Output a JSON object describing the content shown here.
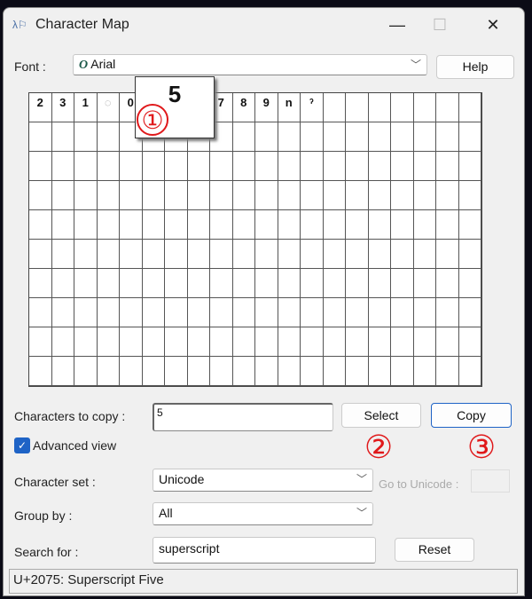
{
  "window": {
    "title": "Character Map",
    "minimize": "—",
    "maximize": "☐",
    "close": "✕"
  },
  "font": {
    "label": "Font :",
    "value": "Arial",
    "font_icon": "O",
    "help": "Help"
  },
  "grid": {
    "columns": 20,
    "rows": 10,
    "cells": [
      "2",
      "3",
      "1",
      "◌",
      "0",
      "",
      "",
      "",
      "7",
      "8",
      "9",
      "n",
      "ˀ"
    ]
  },
  "popup": {
    "char": "5"
  },
  "copy": {
    "label": "Characters to copy :",
    "value": "5",
    "select": "Select",
    "copy": "Copy"
  },
  "advanced": {
    "label": "Advanced view",
    "checked": true
  },
  "charset": {
    "label": "Character set :",
    "value": "Unicode",
    "goto_label": "Go to Unicode :",
    "goto_value": ""
  },
  "groupby": {
    "label": "Group by :",
    "value": "All"
  },
  "search": {
    "label": "Search for :",
    "value": "superscript",
    "reset": "Reset"
  },
  "status": "U+2075: Superscript Five",
  "annotations": [
    "①",
    "②",
    "③"
  ],
  "colors": {
    "annotation": "#e0191b",
    "accent": "#1e63c6"
  }
}
